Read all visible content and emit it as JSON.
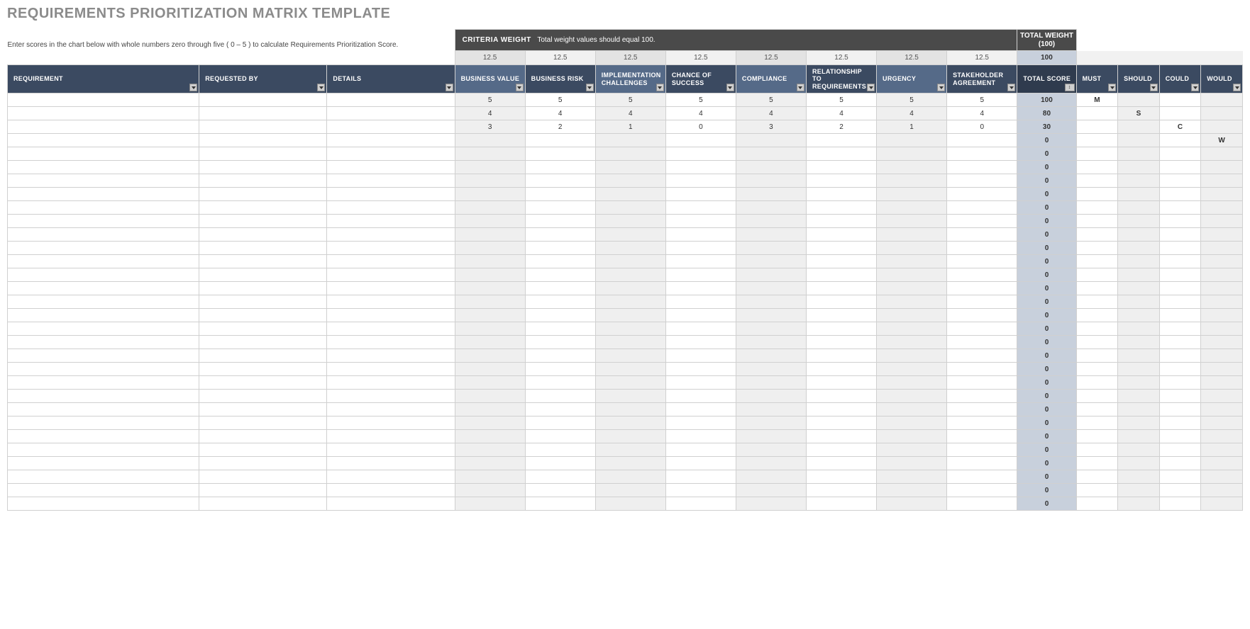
{
  "title": "REQUIREMENTS PRIORITIZATION MATRIX TEMPLATE",
  "instructions": "Enter scores in the chart below with whole numbers zero through five ( 0 – 5 ) to calculate Requirements Prioritization Score.",
  "criteria_banner_label": "CRITERIA WEIGHT",
  "criteria_banner_text": "Total weight values should equal 100.",
  "total_weight_header": "TOTAL WEIGHT (100)",
  "weights": [
    "12.5",
    "12.5",
    "12.5",
    "12.5",
    "12.5",
    "12.5",
    "12.5",
    "12.5"
  ],
  "weights_total": "100",
  "columns": {
    "requirement": "REQUIREMENT",
    "requested_by": "REQUESTED BY",
    "details": "DETAILS",
    "criteria": [
      "BUSINESS VALUE",
      "BUSINESS RISK",
      "IMPLEMENTATION CHALLENGES",
      "CHANCE OF SUCCESS",
      "COMPLIANCE",
      "RELATIONSHIP TO REQUIREMENTS",
      "URGENCY",
      "STAKEHOLDER AGREEMENT"
    ],
    "total_score": "TOTAL SCORE",
    "moscow": [
      "MUST",
      "SHOULD",
      "COULD",
      "WOULD"
    ]
  },
  "rows": [
    {
      "requirement": "",
      "requested_by": "",
      "details": "",
      "scores": [
        "5",
        "5",
        "5",
        "5",
        "5",
        "5",
        "5",
        "5"
      ],
      "total": "100",
      "moscow": [
        "M",
        "",
        "",
        ""
      ]
    },
    {
      "requirement": "",
      "requested_by": "",
      "details": "",
      "scores": [
        "4",
        "4",
        "4",
        "4",
        "4",
        "4",
        "4",
        "4"
      ],
      "total": "80",
      "moscow": [
        "",
        "S",
        "",
        ""
      ]
    },
    {
      "requirement": "",
      "requested_by": "",
      "details": "",
      "scores": [
        "3",
        "2",
        "1",
        "0",
        "3",
        "2",
        "1",
        "0"
      ],
      "total": "30",
      "moscow": [
        "",
        "",
        "C",
        ""
      ]
    },
    {
      "requirement": "",
      "requested_by": "",
      "details": "",
      "scores": [
        "",
        "",
        "",
        "",
        "",
        "",
        "",
        ""
      ],
      "total": "0",
      "moscow": [
        "",
        "",
        "",
        "W"
      ]
    },
    {
      "requirement": "",
      "requested_by": "",
      "details": "",
      "scores": [
        "",
        "",
        "",
        "",
        "",
        "",
        "",
        ""
      ],
      "total": "0",
      "moscow": [
        "",
        "",
        "",
        ""
      ]
    },
    {
      "requirement": "",
      "requested_by": "",
      "details": "",
      "scores": [
        "",
        "",
        "",
        "",
        "",
        "",
        "",
        ""
      ],
      "total": "0",
      "moscow": [
        "",
        "",
        "",
        ""
      ]
    },
    {
      "requirement": "",
      "requested_by": "",
      "details": "",
      "scores": [
        "",
        "",
        "",
        "",
        "",
        "",
        "",
        ""
      ],
      "total": "0",
      "moscow": [
        "",
        "",
        "",
        ""
      ]
    },
    {
      "requirement": "",
      "requested_by": "",
      "details": "",
      "scores": [
        "",
        "",
        "",
        "",
        "",
        "",
        "",
        ""
      ],
      "total": "0",
      "moscow": [
        "",
        "",
        "",
        ""
      ]
    },
    {
      "requirement": "",
      "requested_by": "",
      "details": "",
      "scores": [
        "",
        "",
        "",
        "",
        "",
        "",
        "",
        ""
      ],
      "total": "0",
      "moscow": [
        "",
        "",
        "",
        ""
      ]
    },
    {
      "requirement": "",
      "requested_by": "",
      "details": "",
      "scores": [
        "",
        "",
        "",
        "",
        "",
        "",
        "",
        ""
      ],
      "total": "0",
      "moscow": [
        "",
        "",
        "",
        ""
      ]
    },
    {
      "requirement": "",
      "requested_by": "",
      "details": "",
      "scores": [
        "",
        "",
        "",
        "",
        "",
        "",
        "",
        ""
      ],
      "total": "0",
      "moscow": [
        "",
        "",
        "",
        ""
      ]
    },
    {
      "requirement": "",
      "requested_by": "",
      "details": "",
      "scores": [
        "",
        "",
        "",
        "",
        "",
        "",
        "",
        ""
      ],
      "total": "0",
      "moscow": [
        "",
        "",
        "",
        ""
      ]
    },
    {
      "requirement": "",
      "requested_by": "",
      "details": "",
      "scores": [
        "",
        "",
        "",
        "",
        "",
        "",
        "",
        ""
      ],
      "total": "0",
      "moscow": [
        "",
        "",
        "",
        ""
      ]
    },
    {
      "requirement": "",
      "requested_by": "",
      "details": "",
      "scores": [
        "",
        "",
        "",
        "",
        "",
        "",
        "",
        ""
      ],
      "total": "0",
      "moscow": [
        "",
        "",
        "",
        ""
      ]
    },
    {
      "requirement": "",
      "requested_by": "",
      "details": "",
      "scores": [
        "",
        "",
        "",
        "",
        "",
        "",
        "",
        ""
      ],
      "total": "0",
      "moscow": [
        "",
        "",
        "",
        ""
      ]
    },
    {
      "requirement": "",
      "requested_by": "",
      "details": "",
      "scores": [
        "",
        "",
        "",
        "",
        "",
        "",
        "",
        ""
      ],
      "total": "0",
      "moscow": [
        "",
        "",
        "",
        ""
      ]
    },
    {
      "requirement": "",
      "requested_by": "",
      "details": "",
      "scores": [
        "",
        "",
        "",
        "",
        "",
        "",
        "",
        ""
      ],
      "total": "0",
      "moscow": [
        "",
        "",
        "",
        ""
      ]
    },
    {
      "requirement": "",
      "requested_by": "",
      "details": "",
      "scores": [
        "",
        "",
        "",
        "",
        "",
        "",
        "",
        ""
      ],
      "total": "0",
      "moscow": [
        "",
        "",
        "",
        ""
      ]
    },
    {
      "requirement": "",
      "requested_by": "",
      "details": "",
      "scores": [
        "",
        "",
        "",
        "",
        "",
        "",
        "",
        ""
      ],
      "total": "0",
      "moscow": [
        "",
        "",
        "",
        ""
      ]
    },
    {
      "requirement": "",
      "requested_by": "",
      "details": "",
      "scores": [
        "",
        "",
        "",
        "",
        "",
        "",
        "",
        ""
      ],
      "total": "0",
      "moscow": [
        "",
        "",
        "",
        ""
      ]
    },
    {
      "requirement": "",
      "requested_by": "",
      "details": "",
      "scores": [
        "",
        "",
        "",
        "",
        "",
        "",
        "",
        ""
      ],
      "total": "0",
      "moscow": [
        "",
        "",
        "",
        ""
      ]
    },
    {
      "requirement": "",
      "requested_by": "",
      "details": "",
      "scores": [
        "",
        "",
        "",
        "",
        "",
        "",
        "",
        ""
      ],
      "total": "0",
      "moscow": [
        "",
        "",
        "",
        ""
      ]
    },
    {
      "requirement": "",
      "requested_by": "",
      "details": "",
      "scores": [
        "",
        "",
        "",
        "",
        "",
        "",
        "",
        ""
      ],
      "total": "0",
      "moscow": [
        "",
        "",
        "",
        ""
      ]
    },
    {
      "requirement": "",
      "requested_by": "",
      "details": "",
      "scores": [
        "",
        "",
        "",
        "",
        "",
        "",
        "",
        ""
      ],
      "total": "0",
      "moscow": [
        "",
        "",
        "",
        ""
      ]
    },
    {
      "requirement": "",
      "requested_by": "",
      "details": "",
      "scores": [
        "",
        "",
        "",
        "",
        "",
        "",
        "",
        ""
      ],
      "total": "0",
      "moscow": [
        "",
        "",
        "",
        ""
      ]
    },
    {
      "requirement": "",
      "requested_by": "",
      "details": "",
      "scores": [
        "",
        "",
        "",
        "",
        "",
        "",
        "",
        ""
      ],
      "total": "0",
      "moscow": [
        "",
        "",
        "",
        ""
      ]
    },
    {
      "requirement": "",
      "requested_by": "",
      "details": "",
      "scores": [
        "",
        "",
        "",
        "",
        "",
        "",
        "",
        ""
      ],
      "total": "0",
      "moscow": [
        "",
        "",
        "",
        ""
      ]
    },
    {
      "requirement": "",
      "requested_by": "",
      "details": "",
      "scores": [
        "",
        "",
        "",
        "",
        "",
        "",
        "",
        ""
      ],
      "total": "0",
      "moscow": [
        "",
        "",
        "",
        ""
      ]
    },
    {
      "requirement": "",
      "requested_by": "",
      "details": "",
      "scores": [
        "",
        "",
        "",
        "",
        "",
        "",
        "",
        ""
      ],
      "total": "0",
      "moscow": [
        "",
        "",
        "",
        ""
      ]
    },
    {
      "requirement": "",
      "requested_by": "",
      "details": "",
      "scores": [
        "",
        "",
        "",
        "",
        "",
        "",
        "",
        ""
      ],
      "total": "0",
      "moscow": [
        "",
        "",
        "",
        ""
      ]
    },
    {
      "requirement": "",
      "requested_by": "",
      "details": "",
      "scores": [
        "",
        "",
        "",
        "",
        "",
        "",
        "",
        ""
      ],
      "total": "0",
      "moscow": [
        "",
        "",
        "",
        ""
      ]
    }
  ]
}
